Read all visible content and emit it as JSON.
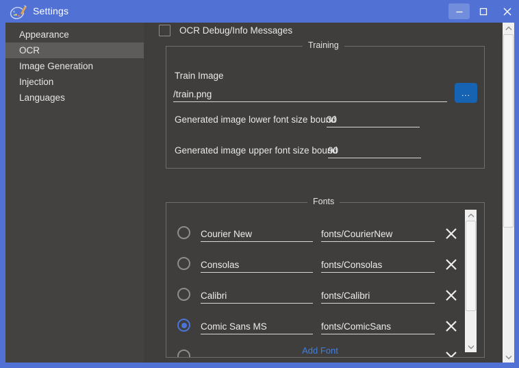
{
  "window": {
    "title": "Settings",
    "app_icon": "palette-icon",
    "controls": {
      "minimize": "minimize-icon",
      "maximize": "maximize-icon",
      "close": "close-icon"
    },
    "accent_color": "#5271d4",
    "background_color": "#3f3e3c"
  },
  "sidebar": {
    "items": [
      {
        "label": "Appearance",
        "selected": false
      },
      {
        "label": "OCR",
        "selected": true
      },
      {
        "label": "Image Generation",
        "selected": false
      },
      {
        "label": "Injection",
        "selected": false
      },
      {
        "label": "Languages",
        "selected": false
      }
    ]
  },
  "main": {
    "debug_checkbox": {
      "label": "OCR Debug/Info Messages",
      "checked": false
    },
    "training": {
      "group_title": "Training",
      "train_image_label": "Train Image",
      "train_image_value": "/train.png",
      "browse_button_label": "...",
      "browse_button_color": "#1763b3",
      "lower_bound_label": "Generated image lower font size bound",
      "lower_bound_value": "30",
      "upper_bound_label": "Generated image upper font size bound",
      "upper_bound_value": "90"
    },
    "fonts": {
      "group_title": "Fonts",
      "add_font_label": "Add Font",
      "add_font_color": "#3f7fe0",
      "rows": [
        {
          "name": "Courier New",
          "path": "fonts/CourierNew",
          "selected": false,
          "delete_icon": "close-icon"
        },
        {
          "name": "Consolas",
          "path": "fonts/Consolas",
          "selected": false,
          "delete_icon": "close-icon"
        },
        {
          "name": "Calibri",
          "path": "fonts/Calibri",
          "selected": false,
          "delete_icon": "close-icon"
        },
        {
          "name": "Comic Sans MS",
          "path": "fonts/ComicSans",
          "selected": true,
          "delete_icon": "close-icon"
        },
        {
          "name": "",
          "path": "",
          "selected": false,
          "delete_icon": "close-icon"
        }
      ]
    }
  }
}
